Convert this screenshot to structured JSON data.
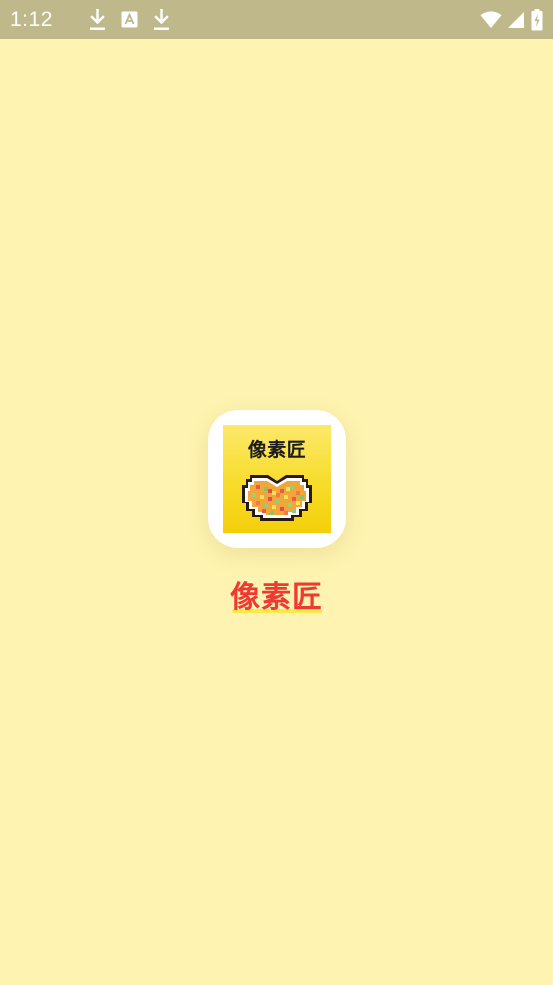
{
  "status_bar": {
    "time": "1:12",
    "left_icons": [
      "download-icon",
      "font-a-icon",
      "download-icon"
    ],
    "right_icons": [
      "wifi-icon",
      "cell-signal-icon",
      "battery-charging-icon"
    ],
    "background": "#BFB88A"
  },
  "splash": {
    "background": "#FEF3B0",
    "app_icon": {
      "caption": "像素匠",
      "art": "pixel-heart-bowl-icon"
    },
    "app_name": "像素匠",
    "app_name_color": "#EE3A32"
  }
}
